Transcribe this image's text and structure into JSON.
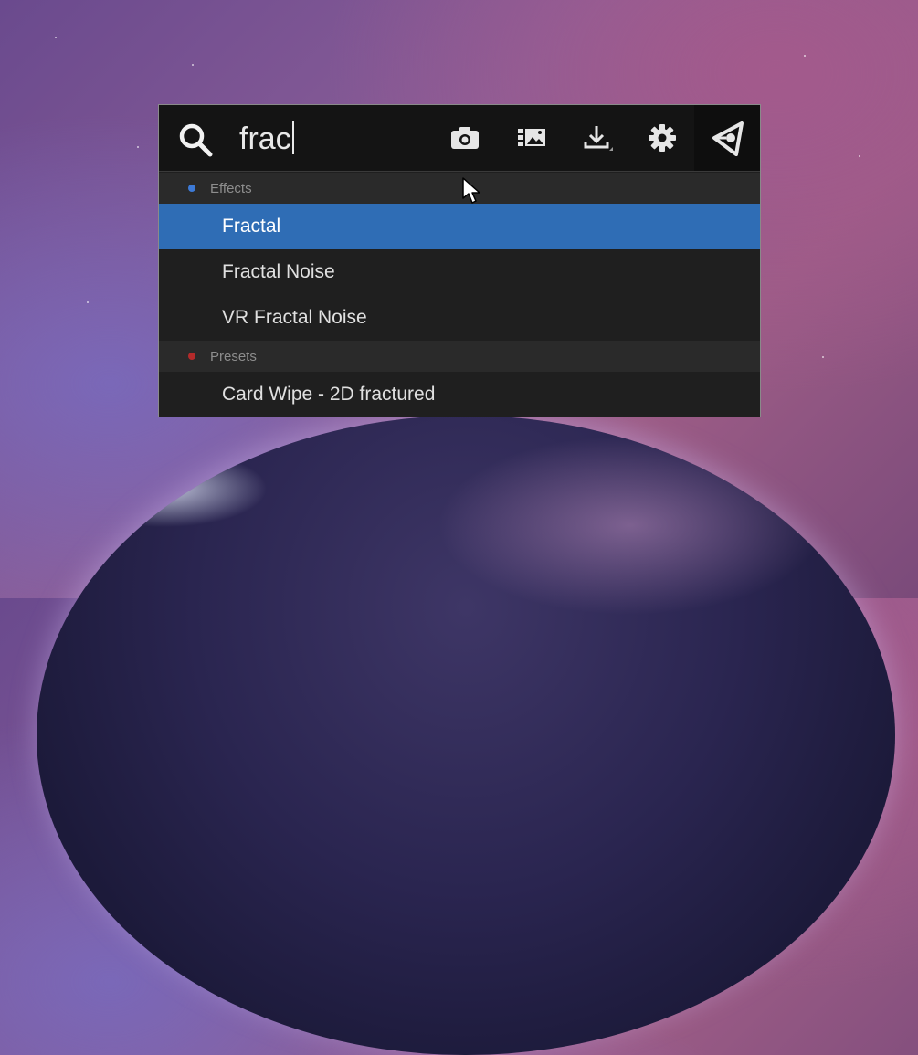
{
  "search": {
    "query": "frac"
  },
  "toolbar": {
    "icons": [
      "camera-icon",
      "image-icon",
      "download-icon",
      "gear-icon",
      "plugin-logo-icon"
    ]
  },
  "results": {
    "categories": [
      {
        "label": "Effects",
        "dot_color": "#3d7ad6",
        "items": [
          {
            "label": "Fractal",
            "selected": true
          },
          {
            "label": "Fractal Noise",
            "selected": false
          },
          {
            "label": "VR Fractal Noise",
            "selected": false
          }
        ]
      },
      {
        "label": "Presets",
        "dot_color": "#b32a2a",
        "items": [
          {
            "label": "Card Wipe - 2D fractured",
            "selected": false
          }
        ]
      }
    ]
  },
  "colors": {
    "selection": "#2f6db5",
    "panel_bg": "#1f1f1f",
    "category_bg": "#2a2a2a"
  }
}
